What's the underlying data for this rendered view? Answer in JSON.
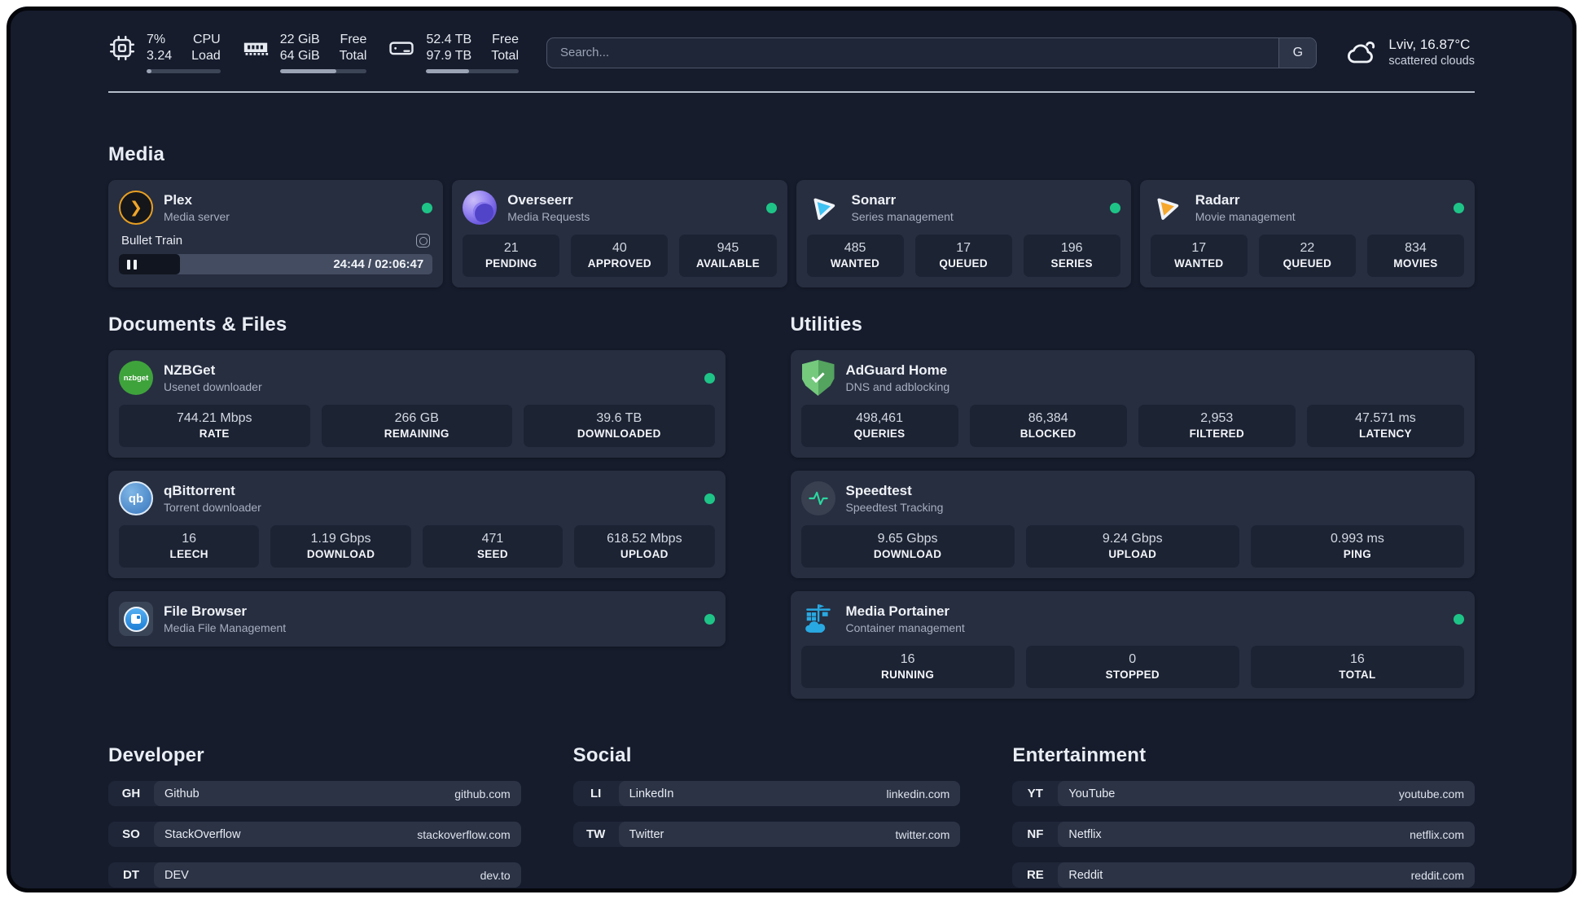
{
  "header": {
    "stats": [
      {
        "id": "cpu",
        "value_top": "7%",
        "value_bottom": "3.24",
        "label_top": "CPU",
        "label_bottom": "Load",
        "progress": 7
      },
      {
        "id": "memory",
        "value_top": "22 GiB",
        "value_bottom": "64 GiB",
        "label_top": "Free",
        "label_bottom": "Total",
        "progress": 65
      },
      {
        "id": "storage",
        "value_top": "52.4 TB",
        "value_bottom": "97.9 TB",
        "label_top": "Free",
        "label_bottom": "Total",
        "progress": 46
      }
    ],
    "search": {
      "placeholder": "Search...",
      "engine_button": "G"
    },
    "weather": {
      "location_temp": "Lviv, 16.87°C",
      "condition": "scattered clouds",
      "icon": "cloud-icon"
    }
  },
  "media": {
    "title": "Media",
    "plex": {
      "name": "Plex",
      "desc": "Media server",
      "status": "online",
      "icon_glyph": "❯",
      "now_playing": "Bullet Train",
      "time": "24:44 / 02:06:47",
      "progress": 19.5
    },
    "overseerr": {
      "name": "Overseerr",
      "desc": "Media Requests",
      "status": "online",
      "stats": [
        {
          "value": "21",
          "label": "PENDING"
        },
        {
          "value": "40",
          "label": "APPROVED"
        },
        {
          "value": "945",
          "label": "AVAILABLE"
        }
      ]
    },
    "sonarr": {
      "name": "Sonarr",
      "desc": "Series management",
      "status": "online",
      "stats": [
        {
          "value": "485",
          "label": "WANTED"
        },
        {
          "value": "17",
          "label": "QUEUED"
        },
        {
          "value": "196",
          "label": "SERIES"
        }
      ]
    },
    "radarr": {
      "name": "Radarr",
      "desc": "Movie management",
      "status": "online",
      "stats": [
        {
          "value": "17",
          "label": "WANTED"
        },
        {
          "value": "22",
          "label": "QUEUED"
        },
        {
          "value": "834",
          "label": "MOVIES"
        }
      ]
    }
  },
  "documents": {
    "title": "Documents & Files",
    "nzbget": {
      "name": "NZBGet",
      "desc": "Usenet downloader",
      "status": "online",
      "icon_glyph": "nzbget",
      "stats": [
        {
          "value": "744.21 Mbps",
          "label": "RATE"
        },
        {
          "value": "266 GB",
          "label": "REMAINING"
        },
        {
          "value": "39.6 TB",
          "label": "DOWNLOADED"
        }
      ]
    },
    "qbittorrent": {
      "name": "qBittorrent",
      "desc": "Torrent downloader",
      "status": "online",
      "icon_glyph": "qb",
      "stats": [
        {
          "value": "16",
          "label": "LEECH"
        },
        {
          "value": "1.19 Gbps",
          "label": "DOWNLOAD"
        },
        {
          "value": "471",
          "label": "SEED"
        },
        {
          "value": "618.52 Mbps",
          "label": "UPLOAD"
        }
      ]
    },
    "filebrowser": {
      "name": "File Browser",
      "desc": "Media File Management",
      "status": "online"
    }
  },
  "utilities": {
    "title": "Utilities",
    "adguard": {
      "name": "AdGuard Home",
      "desc": "DNS and adblocking",
      "stats": [
        {
          "value": "498,461",
          "label": "QUERIES"
        },
        {
          "value": "86,384",
          "label": "BLOCKED"
        },
        {
          "value": "2,953",
          "label": "FILTERED"
        },
        {
          "value": "47.571 ms",
          "label": "LATENCY"
        }
      ]
    },
    "speedtest": {
      "name": "Speedtest",
      "desc": "Speedtest Tracking",
      "stats": [
        {
          "value": "9.65 Gbps",
          "label": "DOWNLOAD"
        },
        {
          "value": "9.24 Gbps",
          "label": "UPLOAD"
        },
        {
          "value": "0.993 ms",
          "label": "PING"
        }
      ]
    },
    "portainer": {
      "name": "Media Portainer",
      "desc": "Container management",
      "status": "online",
      "stats": [
        {
          "value": "16",
          "label": "RUNNING"
        },
        {
          "value": "0",
          "label": "STOPPED"
        },
        {
          "value": "16",
          "label": "TOTAL"
        }
      ]
    }
  },
  "links": {
    "developer": {
      "title": "Developer",
      "items": [
        {
          "abbr": "GH",
          "name": "Github",
          "url": "github.com"
        },
        {
          "abbr": "SO",
          "name": "StackOverflow",
          "url": "stackoverflow.com"
        },
        {
          "abbr": "DT",
          "name": "DEV",
          "url": "dev.to"
        }
      ]
    },
    "social": {
      "title": "Social",
      "items": [
        {
          "abbr": "LI",
          "name": "LinkedIn",
          "url": "linkedin.com"
        },
        {
          "abbr": "TW",
          "name": "Twitter",
          "url": "twitter.com"
        }
      ]
    },
    "entertainment": {
      "title": "Entertainment",
      "items": [
        {
          "abbr": "YT",
          "name": "YouTube",
          "url": "youtube.com"
        },
        {
          "abbr": "NF",
          "name": "Netflix",
          "url": "netflix.com"
        },
        {
          "abbr": "RE",
          "name": "Reddit",
          "url": "reddit.com"
        }
      ]
    }
  },
  "colors": {
    "status_online": "#1ec487",
    "accent_blue": "#3ec1f3",
    "accent_amber": "#f6a82c"
  }
}
